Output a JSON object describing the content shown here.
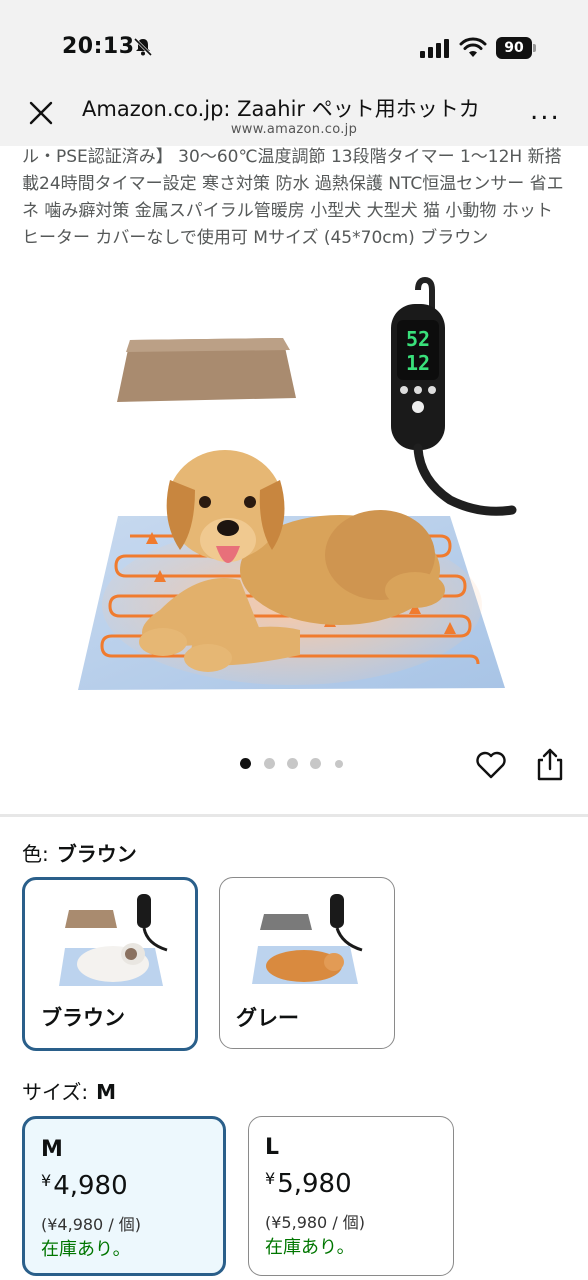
{
  "status_bar": {
    "time": "20:13",
    "battery": "90"
  },
  "browser": {
    "title": "Amazon.co.jp: Zaahir ペット用ホットカ",
    "url": "www.amazon.co.jp",
    "more": "..."
  },
  "product": {
    "description": "ル・PSE認証済み】 30〜60℃温度調節 13段階タイマー 1〜12H 新搭載24時間タイマー設定 寒さ対策 防水 過熱保護 NTC恒温センサー 省エネ 噛み癖対策 金属スパイラル管暖房 小型犬 大型犬 猫 小動物 ホットヒーター カバーなしで使用可 Mサイズ (45*70cm) ブラウン",
    "controller_display": "52 12",
    "image_count": 5,
    "current_image": 1
  },
  "color": {
    "label": "色:",
    "selected": "ブラウン",
    "options": [
      {
        "name": "ブラウン",
        "selected": true
      },
      {
        "name": "グレー",
        "selected": false
      }
    ]
  },
  "size": {
    "label": "サイズ:",
    "selected": "M",
    "options": [
      {
        "name": "M",
        "currency": "¥",
        "price": "4,980",
        "unit_price": "(¥4,980 / 個)",
        "stock": "在庫あり。",
        "selected": true
      },
      {
        "name": "L",
        "currency": "¥",
        "price": "5,980",
        "unit_price": "(¥5,980 / 個)",
        "stock": "在庫あり。",
        "selected": false
      }
    ]
  },
  "colors": {
    "accent_border": "#2a5f8a",
    "selected_bg": "#edf8fd",
    "in_stock": "#007600",
    "led": "#39e07a"
  }
}
